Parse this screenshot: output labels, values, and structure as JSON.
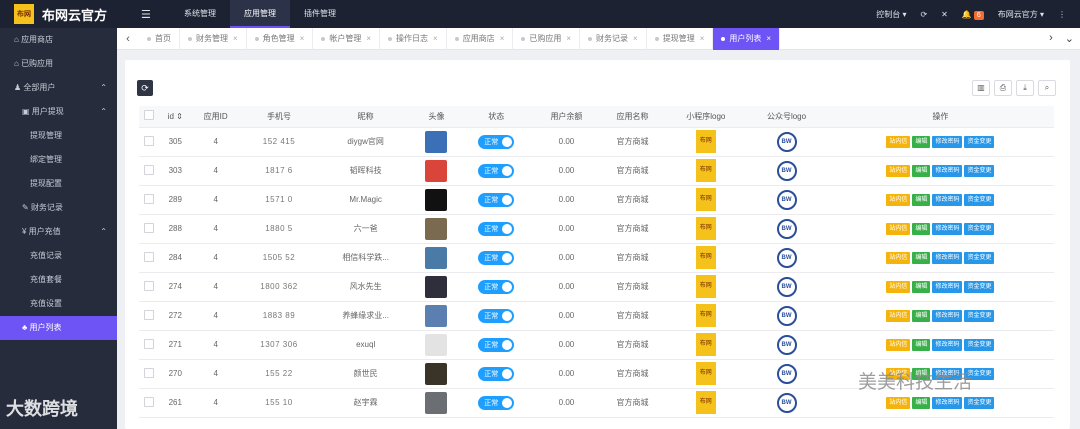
{
  "brand": {
    "name": "布网云官方",
    "logo_text": "布网"
  },
  "topnav": {
    "items": [
      "系统管理",
      "应用管理",
      "插件管理"
    ],
    "active_index": 1
  },
  "topright": {
    "console": "控制台",
    "badge": "6",
    "user": "布网云官方"
  },
  "sidebar": {
    "items": [
      {
        "label": "应用商店",
        "level": 0
      },
      {
        "label": "已购应用",
        "level": 0
      },
      {
        "label": "全部用户",
        "level": 0,
        "caret": "^"
      },
      {
        "label": "用户提现",
        "level": 1,
        "caret": "^"
      },
      {
        "label": "提现管理",
        "level": 2
      },
      {
        "label": "绑定管理",
        "level": 2
      },
      {
        "label": "提现配置",
        "level": 2
      },
      {
        "label": "财务记录",
        "level": 1
      },
      {
        "label": "用户充值",
        "level": 1,
        "caret": "^"
      },
      {
        "label": "充值记录",
        "level": 2
      },
      {
        "label": "充值套餐",
        "level": 2
      },
      {
        "label": "充值设置",
        "level": 2
      },
      {
        "label": "用户列表",
        "level": 1,
        "active": true
      }
    ]
  },
  "tabs": [
    "首页",
    "财务管理",
    "角色管理",
    "帐户管理",
    "操作日志",
    "应用商店",
    "已购应用",
    "财务记录",
    "提现管理",
    "用户列表"
  ],
  "active_tab": 9,
  "table": {
    "headers": [
      "id",
      "应用ID",
      "手机号",
      "昵称",
      "头像",
      "状态",
      "用户余额",
      "应用名称",
      "小程序logo",
      "公众号logo",
      "操作"
    ],
    "status_label": "正常",
    "app_name": "官方商城",
    "mini_logo_text": "布网",
    "gzh_logo_text": "BW",
    "buttons": [
      "站内信",
      "编辑",
      "修改密码",
      "资金变更"
    ],
    "rows": [
      {
        "id": "305",
        "app_id": "4",
        "phone": "152 415",
        "nickname": "diygw官网",
        "balance": "0.00",
        "avatar_color": "#3b6fb6"
      },
      {
        "id": "303",
        "app_id": "4",
        "phone": "1817 6",
        "nickname": "韬晖科技",
        "balance": "0.00",
        "avatar_color": "#d9453b"
      },
      {
        "id": "289",
        "app_id": "4",
        "phone": "1571 0",
        "nickname": "Mr.Magic",
        "balance": "0.00",
        "avatar_color": "#111111"
      },
      {
        "id": "288",
        "app_id": "4",
        "phone": "1880 5",
        "nickname": "六一爸",
        "balance": "0.00",
        "avatar_color": "#7a6a50"
      },
      {
        "id": "284",
        "app_id": "4",
        "phone": "1505 52",
        "nickname": "相信科学跌...",
        "balance": "0.00",
        "avatar_color": "#4a7aa6"
      },
      {
        "id": "274",
        "app_id": "4",
        "phone": "1800 362",
        "nickname": "风水先生",
        "balance": "0.00",
        "avatar_color": "#2e2f3a"
      },
      {
        "id": "272",
        "app_id": "4",
        "phone": "1883 89",
        "nickname": "养蜂缘求业...",
        "balance": "0.00",
        "avatar_color": "#5b7fb0"
      },
      {
        "id": "271",
        "app_id": "4",
        "phone": "1307 306",
        "nickname": "exuql",
        "balance": "0.00",
        "avatar_color": "#e3e3e3"
      },
      {
        "id": "270",
        "app_id": "4",
        "phone": "155 22",
        "nickname": "颜世民",
        "balance": "0.00",
        "avatar_color": "#3a3328"
      },
      {
        "id": "261",
        "app_id": "4",
        "phone": "155 10",
        "nickname": "赵宇霖",
        "balance": "0.00",
        "avatar_color": "#6b6e72"
      }
    ]
  },
  "watermarks": {
    "left": "大数跨境",
    "right": "美美科技生活"
  }
}
